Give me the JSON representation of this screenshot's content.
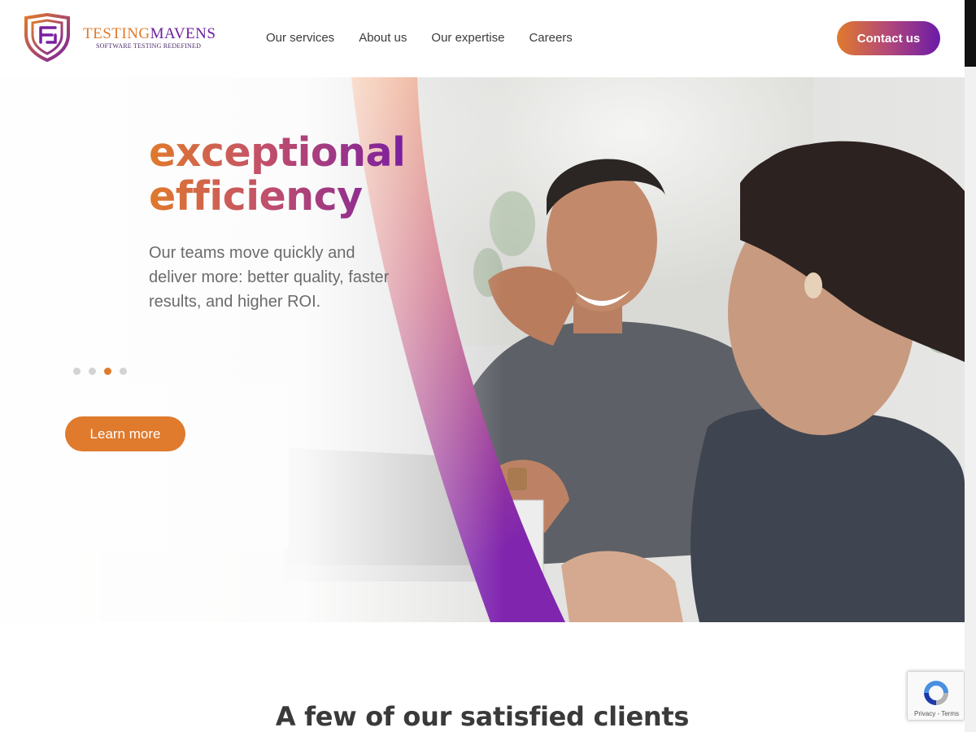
{
  "brand": {
    "name_part1": "TESTING",
    "name_part2": "MAVENS",
    "tagline": "SOFTWARE TESTING REDEFINED",
    "logo_icon": "shield-logo-icon"
  },
  "nav": {
    "items": [
      {
        "label": "Our services"
      },
      {
        "label": "About us"
      },
      {
        "label": "Our expertise"
      },
      {
        "label": "Careers"
      }
    ],
    "contact_label": "Contact us"
  },
  "hero": {
    "headline_line1": "exceptional",
    "headline_line2": "efficiency",
    "subtext": "Our teams move quickly and deliver more: better quality, faster results, and higher ROI.",
    "cta_label": "Learn more",
    "slides": {
      "count": 4,
      "active_index": 2
    }
  },
  "clients": {
    "title": "A few of our satisfied clients"
  },
  "recaptcha": {
    "links": "Privacy - Terms",
    "icon": "recaptcha-icon"
  },
  "colors": {
    "accent_orange": "#e07a2c",
    "accent_purple": "#6a1ba8",
    "text_dark": "#3a3a3a"
  }
}
